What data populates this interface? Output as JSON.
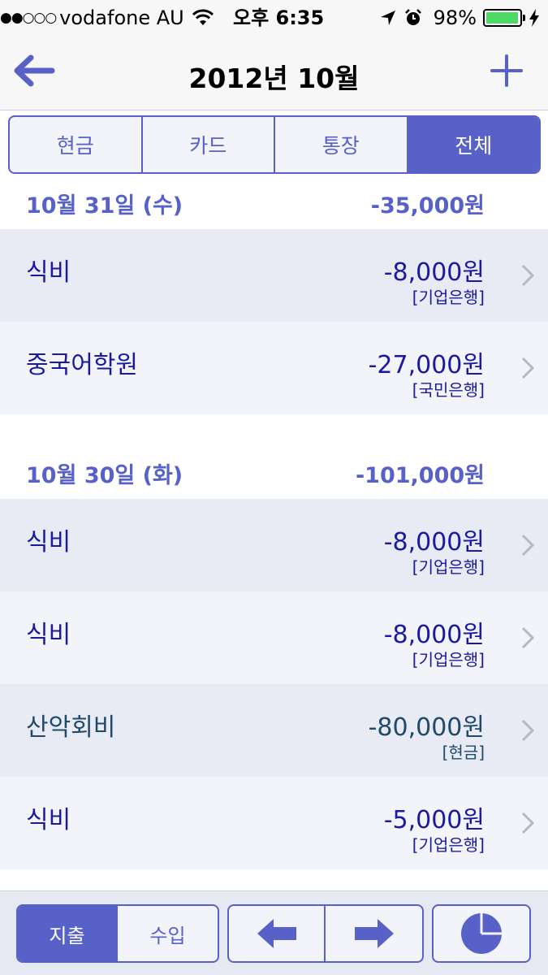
{
  "status_bar": {
    "carrier": "vodafone AU",
    "time": "오후 6:35",
    "battery": "98%",
    "battery_level": 0.98
  },
  "nav": {
    "title": "2012년 10월",
    "back_icon": "arrow-left-icon",
    "add_icon": "plus-icon"
  },
  "tabs": [
    {
      "label": "현금",
      "active": false
    },
    {
      "label": "카드",
      "active": false
    },
    {
      "label": "통장",
      "active": false
    },
    {
      "label": "전체",
      "active": true
    }
  ],
  "days": [
    {
      "date": "10월 31일 (수)",
      "total": "-35,000원",
      "entries": [
        {
          "category": "식비",
          "amount": "-8,000원",
          "account": "[기업은행]"
        },
        {
          "category": "중국어학원",
          "amount": "-27,000원",
          "account": "[국민은행]"
        }
      ]
    },
    {
      "date": "10월 30일 (화)",
      "total": "-101,000원",
      "entries": [
        {
          "category": "식비",
          "amount": "-8,000원",
          "account": "[기업은행]"
        },
        {
          "category": "식비",
          "amount": "-8,000원",
          "account": "[기업은행]"
        },
        {
          "category": "산악회비",
          "amount": "-80,000원",
          "account": "[현금]"
        },
        {
          "category": "식비",
          "amount": "-5,000원",
          "account": "[기업은행]"
        }
      ]
    }
  ],
  "toolbar": {
    "expense_label": "지출",
    "income_label": "수입",
    "prev_icon": "arrow-left-icon",
    "next_icon": "arrow-right-icon",
    "chart_icon": "pie-chart-icon"
  },
  "colors": {
    "accent": "#5861c7",
    "text": "#1a1aa0",
    "cash_text": "#204a6a",
    "row_odd": "#e8eaf4",
    "row_even": "#f3f4fa"
  }
}
